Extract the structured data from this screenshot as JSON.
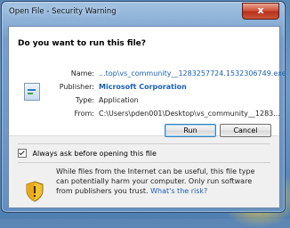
{
  "window": {
    "title": "Open File - Security Warning",
    "close_symbol": "x"
  },
  "dialog": {
    "question": "Do you want to run this file?",
    "fields": [
      {
        "label": "Name:",
        "value": "...top\\vs_community__1283257724.1532306749.exe"
      },
      {
        "label": "Publisher:",
        "value": "Microsoft Corporation"
      },
      {
        "label": "Type:",
        "value": "Application"
      },
      {
        "label": "From:",
        "value": "C:\\Users\\pden001\\Desktop\\vs_community__1283..."
      }
    ],
    "run_label": "Run",
    "cancel_label": "Cancel",
    "always_ask_label": "Always ask before opening this file",
    "always_ask_checked": true,
    "warning_text": "While files from the Internet can be useful, this file type can potentially harm your computer. Only run software from publishers you trust.",
    "warning_link": "What's the risk?"
  },
  "icons": {
    "app": "application-icon",
    "warning": "shield-warning-icon"
  }
}
